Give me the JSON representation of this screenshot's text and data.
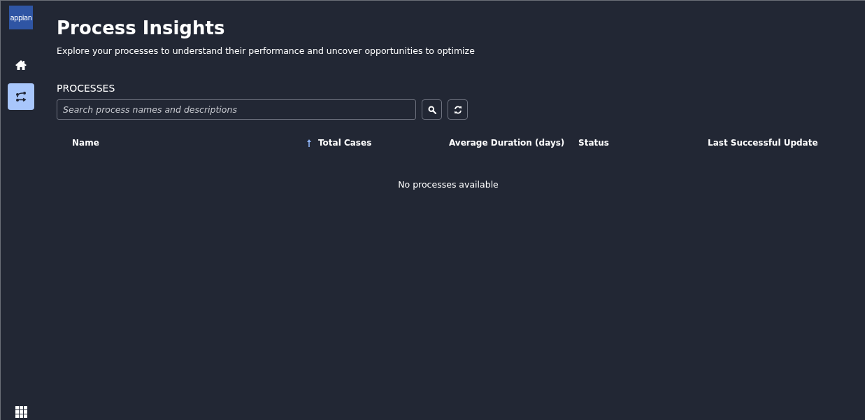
{
  "sidebar": {
    "logo": "appian",
    "items": [
      {
        "kind": "home",
        "selected": false
      },
      {
        "kind": "process",
        "selected": true
      }
    ]
  },
  "header": {
    "title": "Process Insights",
    "subtitle": "Explore your processes to understand their performance and uncover opportunities to optimize"
  },
  "section_title": "PROCESSES",
  "search": {
    "placeholder": "Search process names and descriptions"
  },
  "table": {
    "columns": [
      {
        "label": "Name",
        "sorted": false
      },
      {
        "label": "Total Cases",
        "sorted": true
      },
      {
        "label": "Average Duration (days)",
        "sorted": false
      },
      {
        "label": "Status",
        "sorted": false
      },
      {
        "label": "Last Successful Update",
        "sorted": false
      }
    ],
    "empty_message": "No processes available"
  }
}
